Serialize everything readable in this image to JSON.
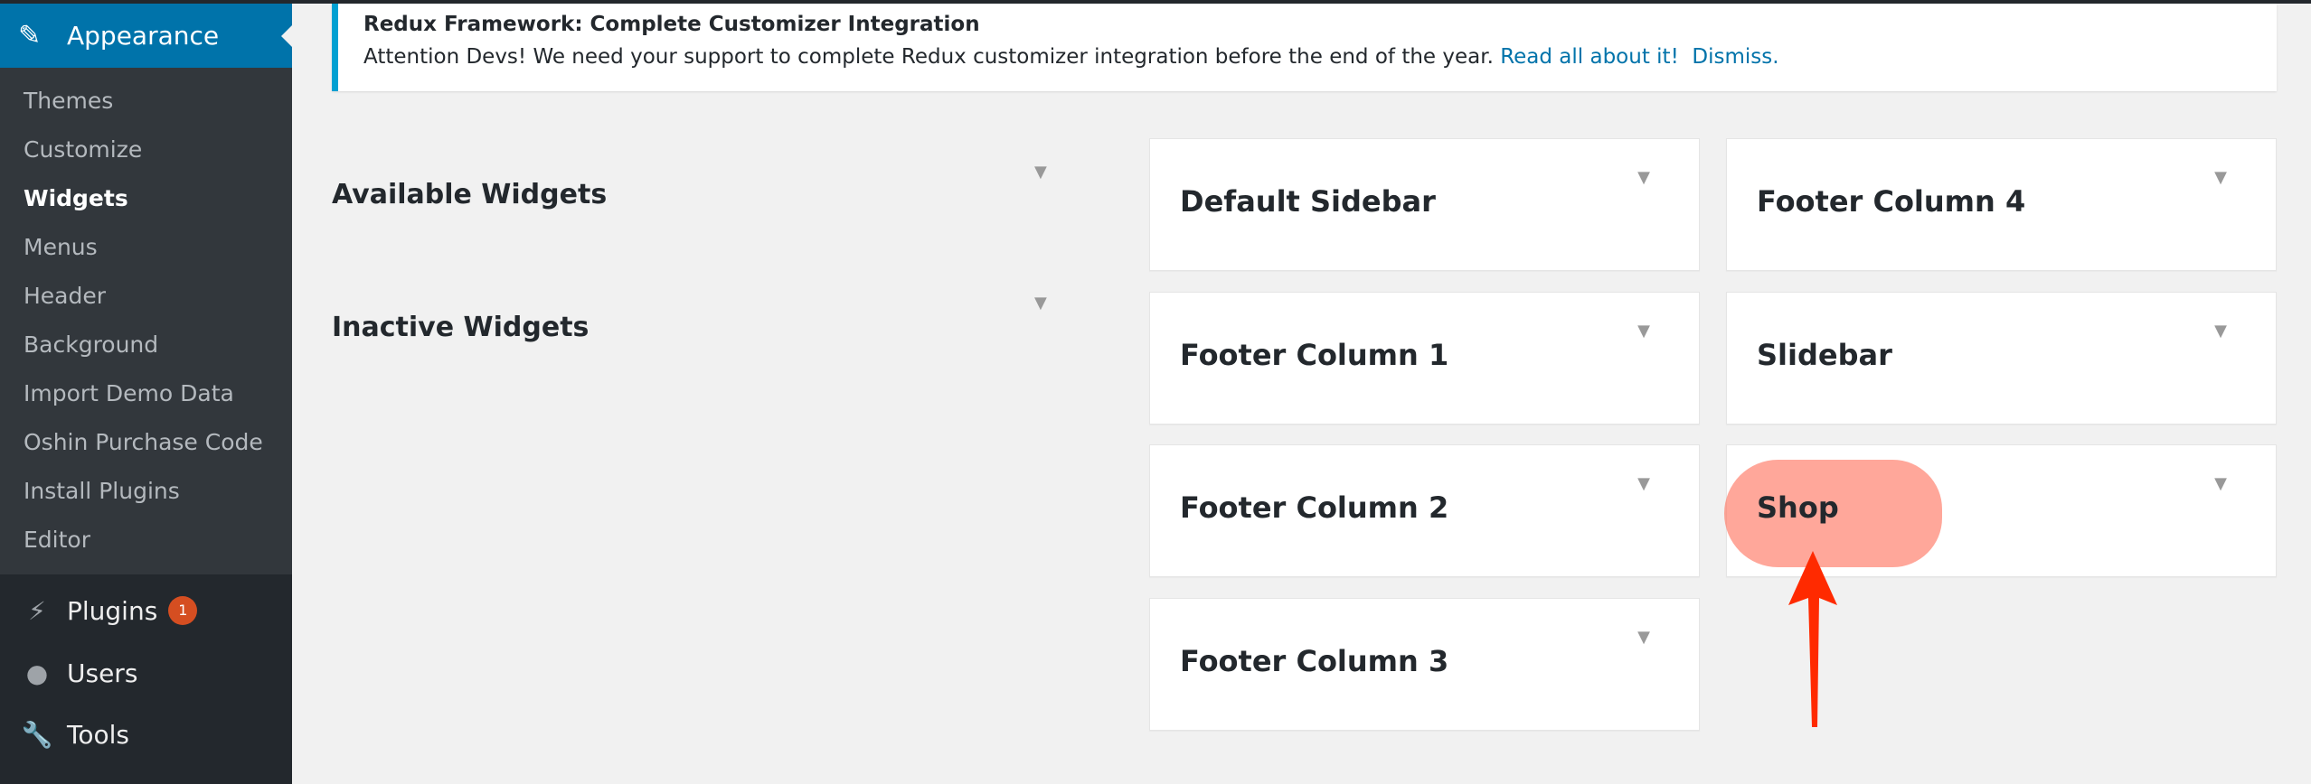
{
  "sidebar": {
    "active": {
      "label": "Appearance",
      "icon": "paintbrush-icon"
    },
    "submenu": [
      "Themes",
      "Customize",
      "Widgets",
      "Menus",
      "Header",
      "Background",
      "Import Demo Data",
      "Oshin Purchase Code",
      "Install Plugins",
      "Editor"
    ],
    "current": "Widgets",
    "items": [
      {
        "label": "Plugins",
        "icon": "plugin-icon",
        "badge": "1"
      },
      {
        "label": "Users",
        "icon": "user-icon"
      },
      {
        "label": "Tools",
        "icon": "wrench-icon"
      }
    ]
  },
  "notice": {
    "title": "Redux Framework: Complete Customizer Integration",
    "message": "Attention Devs! We need your support to complete Redux customizer integration before the end of the year.",
    "link": "Read all about it!",
    "dismiss": "Dismiss."
  },
  "left": {
    "available": "Available Widgets",
    "inactive": "Inactive Widgets"
  },
  "areas": [
    "Default Sidebar",
    "Footer Column 4",
    "Footer Column 1",
    "Slidebar",
    "Footer Column 2",
    "Shop",
    "Footer Column 3"
  ],
  "colors": {
    "accent": "#0073aa",
    "highlight": "#ff7864",
    "arrow": "#ff2a00"
  }
}
